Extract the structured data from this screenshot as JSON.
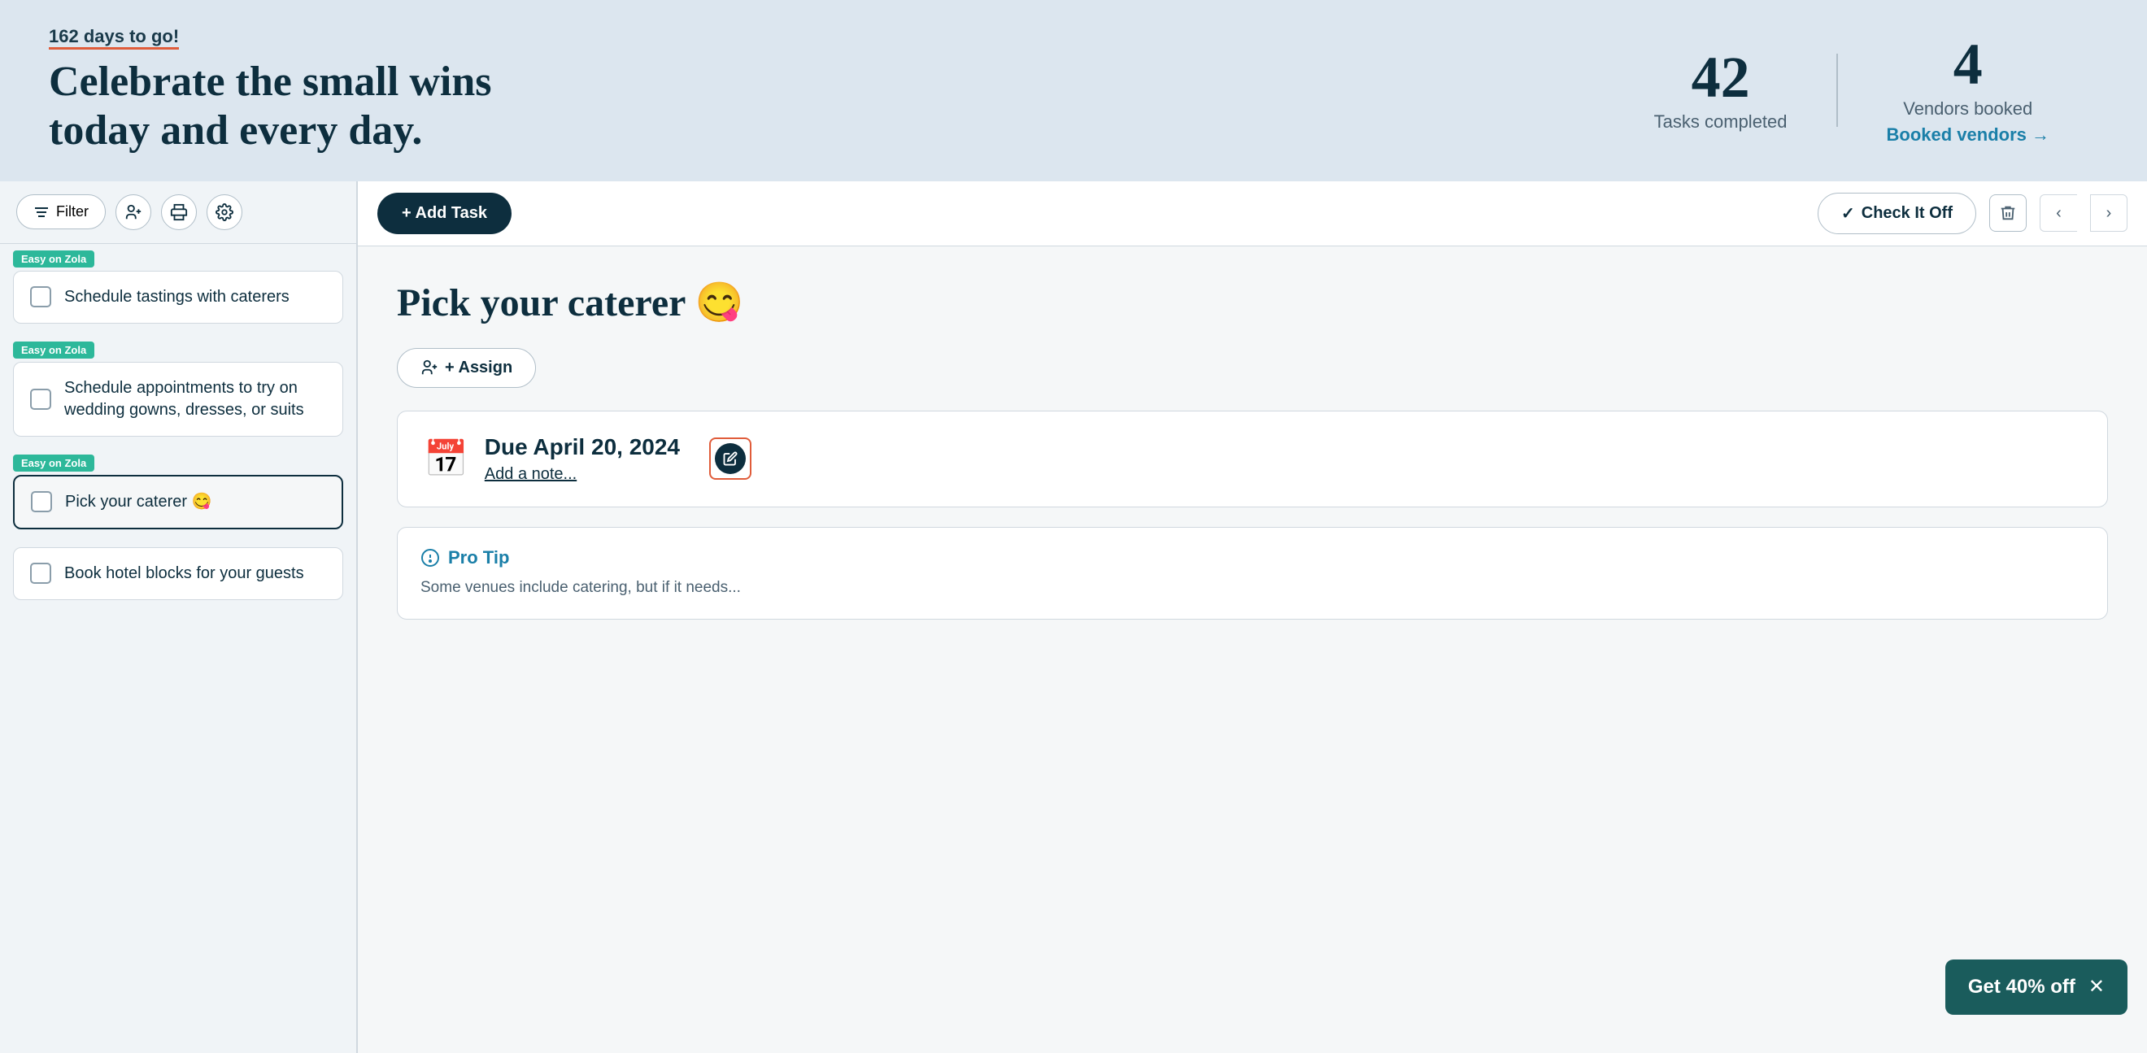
{
  "header": {
    "days_to_go": "162 days to go!",
    "title_line1": "Celebrate the small wins",
    "title_line2": "today and every day.",
    "stat1_number": "42",
    "stat1_label": "Tasks completed",
    "stat2_number": "4",
    "stat2_label": "Vendors booked",
    "stat2_link": "Booked vendors →"
  },
  "toolbar": {
    "filter_label": "Filter",
    "add_person_icon": "👤+",
    "print_icon": "🖨",
    "settings_icon": "⚙"
  },
  "tasks": [
    {
      "id": "task1",
      "badge": "Easy on Zola",
      "text": "Schedule tastings with caterers",
      "selected": false
    },
    {
      "id": "task2",
      "badge": "Easy on Zola",
      "text": "Schedule appointments to try on wedding gowns, dresses, or suits",
      "selected": false
    },
    {
      "id": "task3",
      "badge": "Easy on Zola",
      "text": "Pick your caterer 😋",
      "selected": true
    },
    {
      "id": "task4",
      "badge": null,
      "text": "Book hotel blocks for your guests",
      "selected": false
    }
  ],
  "detail": {
    "add_task_label": "+ Add Task",
    "check_it_off_label": "✓ Check It Off",
    "title": "Pick your caterer 😋",
    "assign_label": "+ Assign",
    "due_date": "Due April 20, 2024",
    "add_note": "Add a note...",
    "pro_tip_label": "Pro Tip",
    "pro_tip_text": "Some venues include catering, but if it needs..."
  },
  "discount": {
    "label": "Get 40% off"
  }
}
